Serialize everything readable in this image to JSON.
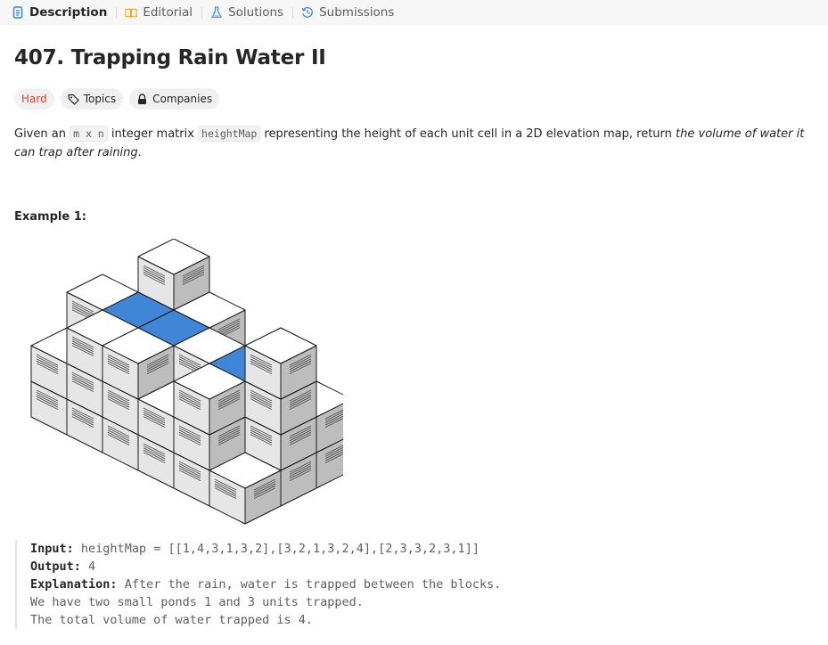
{
  "tabs": [
    {
      "label": "Description",
      "icon": "description-icon",
      "active": true
    },
    {
      "label": "Editorial",
      "icon": "book-icon"
    },
    {
      "label": "Solutions",
      "icon": "flask-icon"
    },
    {
      "label": "Submissions",
      "icon": "history-icon"
    }
  ],
  "problem": {
    "title": "407. Trapping Rain Water II",
    "difficulty": "Hard",
    "topics_label": "Topics",
    "companies_label": "Companies"
  },
  "description": {
    "p1": "Given an ",
    "code1": "m x n",
    "p2": " integer matrix ",
    "code2": "heightMap",
    "p3": " representing the height of each unit cell in a 2D elevation map, return ",
    "em": "the volume of water it can trap after raining",
    "p4": "."
  },
  "example": {
    "title": "Example 1:",
    "input_label": "Input:",
    "input_value": "heightMap = [[1,4,3,1,3,2],[3,2,1,3,2,4],[2,3,3,2,3,1]]",
    "output_label": "Output:",
    "output_value": "4",
    "explanation_label": "Explanation:",
    "explanation_lines": [
      "After the rain, water is trapped between the blocks.",
      "We have two small ponds 1 and 3 units trapped.",
      "The total volume of water trapped is 4."
    ]
  },
  "colors": {
    "hard": "#e0432f",
    "water": "#3f86d6",
    "block_top": "#ffffff",
    "block_left": "#e6e6e6",
    "block_right": "#bdbdbd"
  }
}
